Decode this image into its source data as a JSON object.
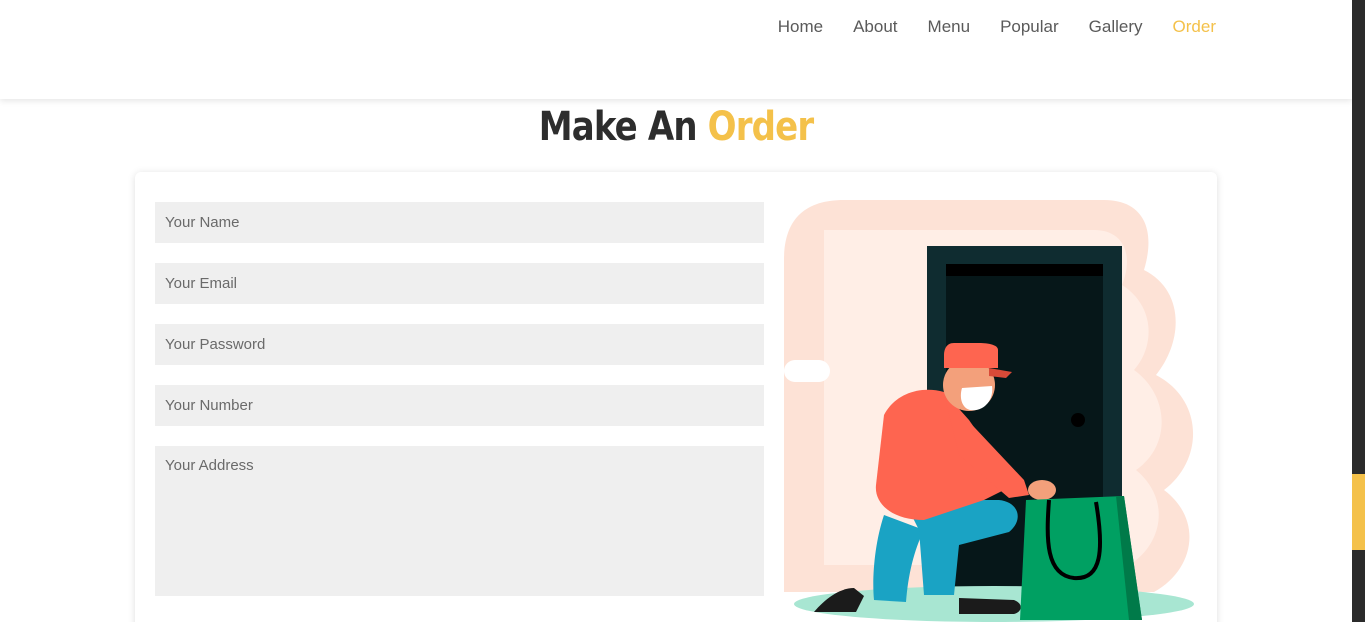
{
  "nav": {
    "items": [
      {
        "label": "Home"
      },
      {
        "label": "About"
      },
      {
        "label": "Menu"
      },
      {
        "label": "Popular"
      },
      {
        "label": "Gallery"
      },
      {
        "label": "Order",
        "active": true
      }
    ]
  },
  "section": {
    "title_main": "Make An",
    "title_accent": "Order"
  },
  "form": {
    "name_placeholder": "Your Name",
    "email_placeholder": "Your Email",
    "password_placeholder": "Your Password",
    "number_placeholder": "Your Number",
    "address_placeholder": "Your Address"
  },
  "colors": {
    "accent": "#f4c14a",
    "field_bg": "#efefef",
    "scrollbar_track": "#2b2b2b"
  },
  "icons": {
    "illustration": "delivery-person-illustration"
  }
}
